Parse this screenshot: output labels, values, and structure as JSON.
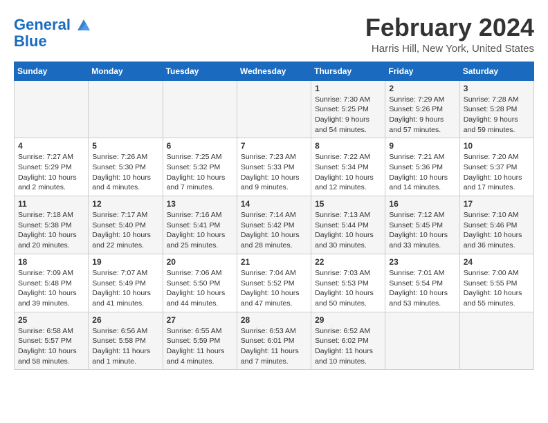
{
  "header": {
    "logo_line1": "General",
    "logo_line2": "Blue",
    "month": "February 2024",
    "location": "Harris Hill, New York, United States"
  },
  "days_of_week": [
    "Sunday",
    "Monday",
    "Tuesday",
    "Wednesday",
    "Thursday",
    "Friday",
    "Saturday"
  ],
  "weeks": [
    [
      {
        "day": "",
        "info": ""
      },
      {
        "day": "",
        "info": ""
      },
      {
        "day": "",
        "info": ""
      },
      {
        "day": "",
        "info": ""
      },
      {
        "day": "1",
        "info": "Sunrise: 7:30 AM\nSunset: 5:25 PM\nDaylight: 9 hours\nand 54 minutes."
      },
      {
        "day": "2",
        "info": "Sunrise: 7:29 AM\nSunset: 5:26 PM\nDaylight: 9 hours\nand 57 minutes."
      },
      {
        "day": "3",
        "info": "Sunrise: 7:28 AM\nSunset: 5:28 PM\nDaylight: 9 hours\nand 59 minutes."
      }
    ],
    [
      {
        "day": "4",
        "info": "Sunrise: 7:27 AM\nSunset: 5:29 PM\nDaylight: 10 hours\nand 2 minutes."
      },
      {
        "day": "5",
        "info": "Sunrise: 7:26 AM\nSunset: 5:30 PM\nDaylight: 10 hours\nand 4 minutes."
      },
      {
        "day": "6",
        "info": "Sunrise: 7:25 AM\nSunset: 5:32 PM\nDaylight: 10 hours\nand 7 minutes."
      },
      {
        "day": "7",
        "info": "Sunrise: 7:23 AM\nSunset: 5:33 PM\nDaylight: 10 hours\nand 9 minutes."
      },
      {
        "day": "8",
        "info": "Sunrise: 7:22 AM\nSunset: 5:34 PM\nDaylight: 10 hours\nand 12 minutes."
      },
      {
        "day": "9",
        "info": "Sunrise: 7:21 AM\nSunset: 5:36 PM\nDaylight: 10 hours\nand 14 minutes."
      },
      {
        "day": "10",
        "info": "Sunrise: 7:20 AM\nSunset: 5:37 PM\nDaylight: 10 hours\nand 17 minutes."
      }
    ],
    [
      {
        "day": "11",
        "info": "Sunrise: 7:18 AM\nSunset: 5:38 PM\nDaylight: 10 hours\nand 20 minutes."
      },
      {
        "day": "12",
        "info": "Sunrise: 7:17 AM\nSunset: 5:40 PM\nDaylight: 10 hours\nand 22 minutes."
      },
      {
        "day": "13",
        "info": "Sunrise: 7:16 AM\nSunset: 5:41 PM\nDaylight: 10 hours\nand 25 minutes."
      },
      {
        "day": "14",
        "info": "Sunrise: 7:14 AM\nSunset: 5:42 PM\nDaylight: 10 hours\nand 28 minutes."
      },
      {
        "day": "15",
        "info": "Sunrise: 7:13 AM\nSunset: 5:44 PM\nDaylight: 10 hours\nand 30 minutes."
      },
      {
        "day": "16",
        "info": "Sunrise: 7:12 AM\nSunset: 5:45 PM\nDaylight: 10 hours\nand 33 minutes."
      },
      {
        "day": "17",
        "info": "Sunrise: 7:10 AM\nSunset: 5:46 PM\nDaylight: 10 hours\nand 36 minutes."
      }
    ],
    [
      {
        "day": "18",
        "info": "Sunrise: 7:09 AM\nSunset: 5:48 PM\nDaylight: 10 hours\nand 39 minutes."
      },
      {
        "day": "19",
        "info": "Sunrise: 7:07 AM\nSunset: 5:49 PM\nDaylight: 10 hours\nand 41 minutes."
      },
      {
        "day": "20",
        "info": "Sunrise: 7:06 AM\nSunset: 5:50 PM\nDaylight: 10 hours\nand 44 minutes."
      },
      {
        "day": "21",
        "info": "Sunrise: 7:04 AM\nSunset: 5:52 PM\nDaylight: 10 hours\nand 47 minutes."
      },
      {
        "day": "22",
        "info": "Sunrise: 7:03 AM\nSunset: 5:53 PM\nDaylight: 10 hours\nand 50 minutes."
      },
      {
        "day": "23",
        "info": "Sunrise: 7:01 AM\nSunset: 5:54 PM\nDaylight: 10 hours\nand 53 minutes."
      },
      {
        "day": "24",
        "info": "Sunrise: 7:00 AM\nSunset: 5:55 PM\nDaylight: 10 hours\nand 55 minutes."
      }
    ],
    [
      {
        "day": "25",
        "info": "Sunrise: 6:58 AM\nSunset: 5:57 PM\nDaylight: 10 hours\nand 58 minutes."
      },
      {
        "day": "26",
        "info": "Sunrise: 6:56 AM\nSunset: 5:58 PM\nDaylight: 11 hours\nand 1 minute."
      },
      {
        "day": "27",
        "info": "Sunrise: 6:55 AM\nSunset: 5:59 PM\nDaylight: 11 hours\nand 4 minutes."
      },
      {
        "day": "28",
        "info": "Sunrise: 6:53 AM\nSunset: 6:01 PM\nDaylight: 11 hours\nand 7 minutes."
      },
      {
        "day": "29",
        "info": "Sunrise: 6:52 AM\nSunset: 6:02 PM\nDaylight: 11 hours\nand 10 minutes."
      },
      {
        "day": "",
        "info": ""
      },
      {
        "day": "",
        "info": ""
      }
    ]
  ]
}
